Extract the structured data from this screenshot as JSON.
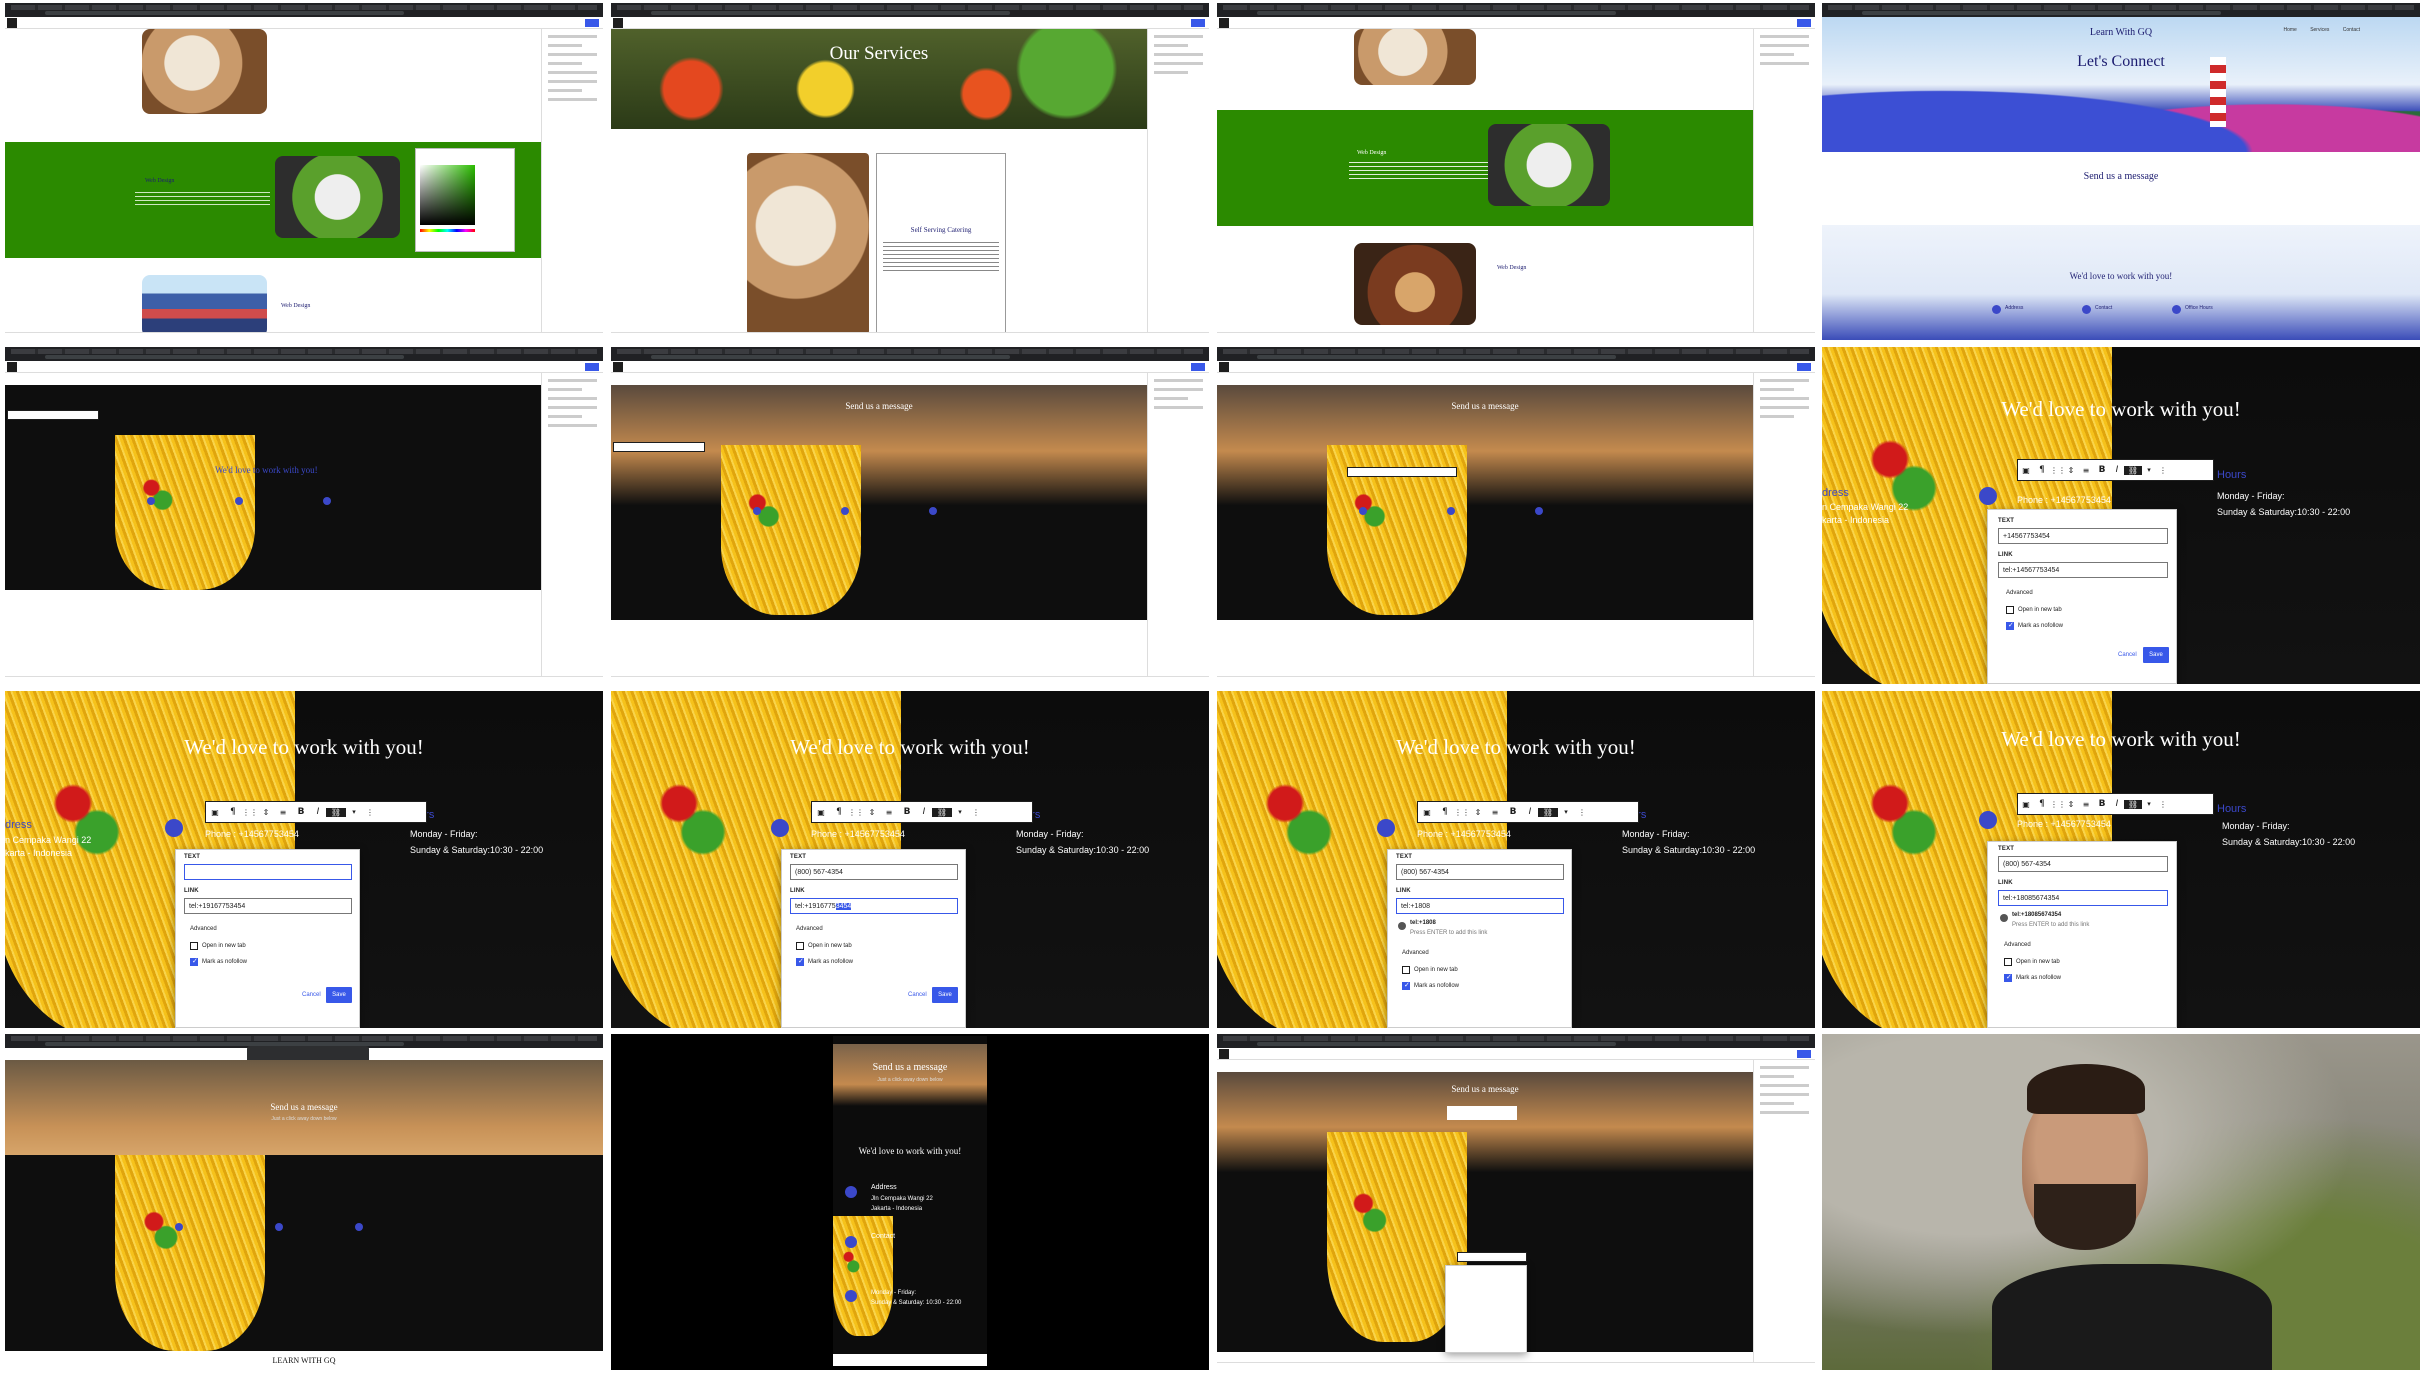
{
  "tile1": {
    "green_block_title": "Web Design",
    "lower_block_title": "Web Design"
  },
  "tile2": {
    "hero_title": "Our Services",
    "card_title": "Self Serving Catering"
  },
  "tile3": {
    "green_block_title": "Web Design",
    "lower_block_title": "Web Design"
  },
  "tile4": {
    "site_title": "Learn With GQ",
    "nav": [
      "Home",
      "Services",
      "Contact"
    ],
    "hero_title": "Let's Connect",
    "message_title": "Send us a message",
    "work_title": "We'd love to work with you!",
    "contacts": [
      "Address",
      "Contact",
      "Office Hours"
    ]
  },
  "tile5": {
    "headline": "We'd love to work with you!"
  },
  "tile6": {
    "headline": "Send us a message"
  },
  "tile7": {
    "headline": "Send us a message"
  },
  "zoom_tiles": {
    "headline": "We'd love to work with you!",
    "address_fragment": "dress",
    "address_line1": "n Cempaka Wangi 22",
    "address_line2": "karta - Indonesia",
    "phone": "Phone : +14567753454",
    "hours_title": "Hours",
    "hours_weekday": "Monday - Friday:",
    "hours_weekend": "Sunday & Saturday:10:30 - 22:00",
    "text_label": "TEXT",
    "link_label": "LINK",
    "advanced_label": "Advanced",
    "open_new_tab": "Open in new tab",
    "mark_nofollow": "Mark as nofollow",
    "cancel": "Cancel",
    "save": "Save",
    "enter_hint": "Press ENTER to add this link"
  },
  "tile8": {
    "text_value": "+14567753454",
    "link_value": "tel:+14567753454"
  },
  "tile9": {
    "text_value": "",
    "link_value": "tel:+19167753454"
  },
  "tile10": {
    "text_value": "(800) 567-4354",
    "link_value_pre": "tel:+1916775",
    "link_value_sel": "3454"
  },
  "tile11": {
    "text_value": "(800) 567-4354",
    "link_value": "tel:+1808",
    "suggestion": "tel:+1808"
  },
  "tile12": {
    "text_value": "(800) 567-4354",
    "link_value": "tel:+18085674354",
    "suggestion": "tel:+18085674354"
  },
  "tile13": {
    "headline": "Send us a message",
    "sub": "Just a click away down below",
    "footer_brand": "LEARN WITH GQ"
  },
  "tile14": {
    "headline": "Send us a message",
    "sub": "Just a click away down below",
    "work_title": "We'd love to work with you!",
    "address_title": "Address",
    "address_line1": "Jln Cempaka Wangi 22",
    "address_line2": "Jakarta - Indonesia",
    "contact_title": "Contact",
    "hours_weekday": "Monday - Friday:",
    "hours_weekend": "Sunday & Saturday: 10:30 - 22:00"
  },
  "tile15": {
    "headline": "Send us a message"
  },
  "colors": {
    "accent": "#3858e9",
    "green_block": "#2b8a00",
    "icon_circle": "#3b48c9",
    "headline_text": "#ffffff"
  }
}
